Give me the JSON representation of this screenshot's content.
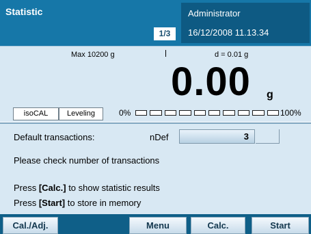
{
  "header": {
    "title": "Statistic",
    "page_indicator": "1/3",
    "user": "Administrator",
    "datetime": "16/12/2008 11.13.34",
    "accent_color": "#1677a8"
  },
  "display": {
    "max_label": "Max 10200 g",
    "d_label": "d = 0.01 g",
    "weight_value": "0.00",
    "weight_unit": "g",
    "chips": [
      "isoCAL",
      "Leveling"
    ],
    "bar_start_label": "0%",
    "bar_end_label": "100%",
    "bar_fill_fraction": 0
  },
  "content": {
    "field_label": "Default transactions:",
    "field_code": "nDef",
    "field_value": "3",
    "message": "Please check number of transactions",
    "hint_1_prefix": "Press ",
    "hint_1_key": "[Calc.]",
    "hint_1_suffix": " to show statistic results",
    "hint_2_prefix": "Press ",
    "hint_2_key": "[Start]",
    "hint_2_suffix": " to store in memory"
  },
  "softkeys": {
    "cal_adj": "Cal./Adj.",
    "menu": "Menu",
    "calc": "Calc.",
    "start": "Start"
  }
}
